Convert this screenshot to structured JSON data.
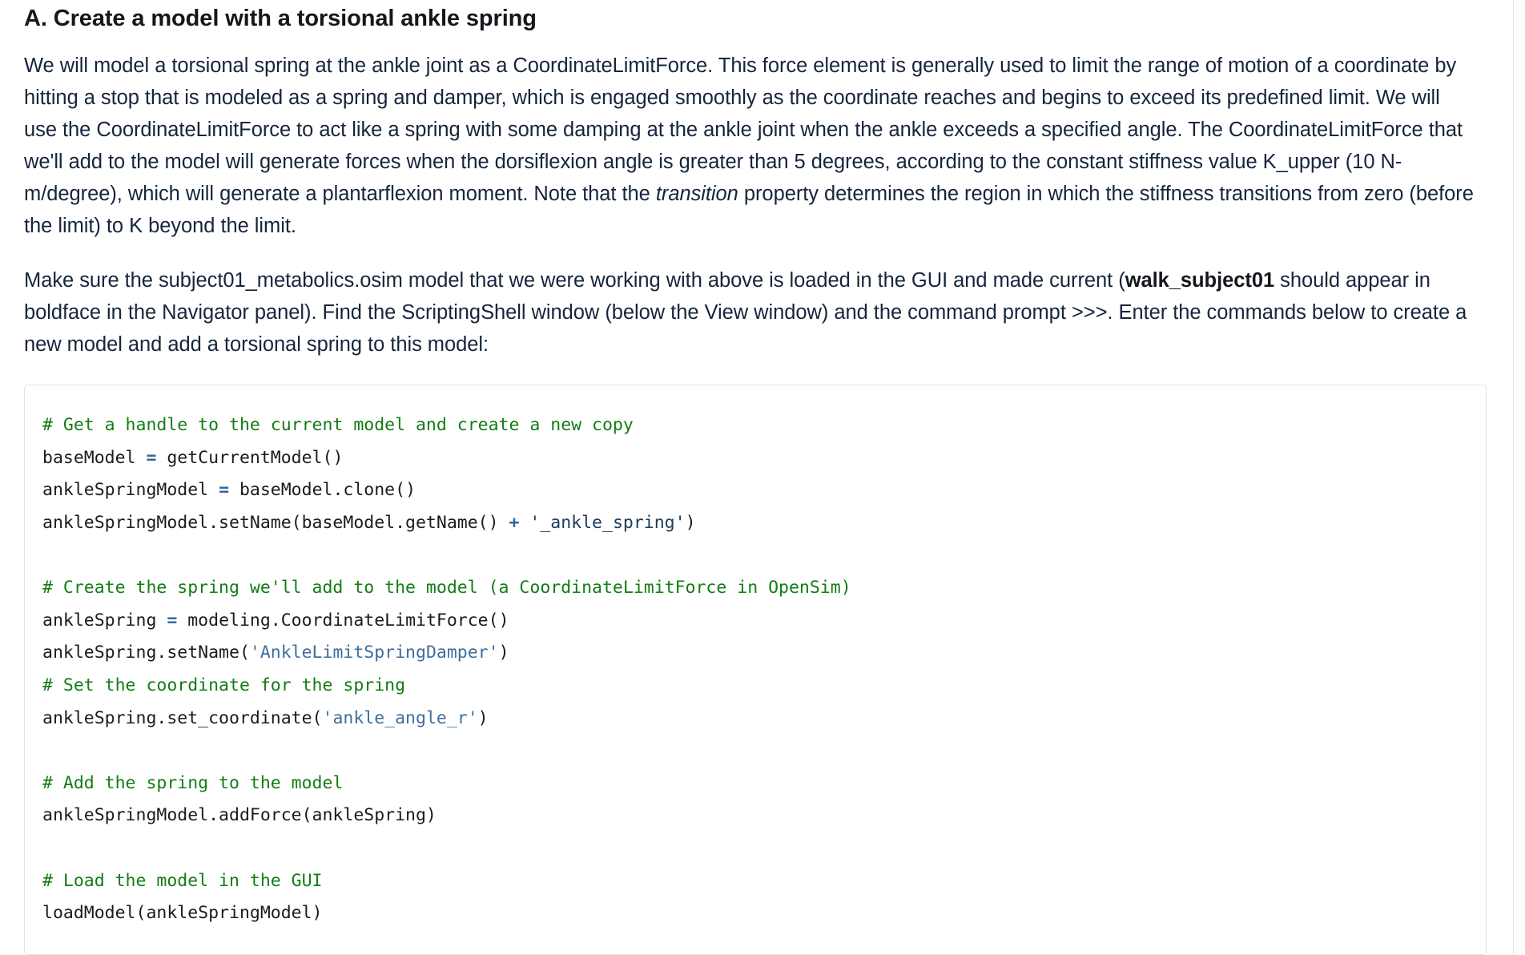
{
  "heading": "A. Create a model with a torsional ankle spring",
  "paragraphs": {
    "p1_part1": "We will model a torsional spring at the ankle joint as a CoordinateLimitForce. This force element is generally used to limit the range of motion of a coordinate by hitting a stop that is modeled as a spring and damper, which is engaged smoothly as the coordinate reaches and begins to exceed its predefined limit. We will use the CoordinateLimitForce to act like a spring with some damping at the ankle joint when the ankle exceeds a specified angle. The CoordinateLimitForce that we'll add to the model will generate forces when the dorsiflexion angle is greater than 5 degrees, according to the constant stiffness value K_upper (10 N-m/degree), which will generate a plantarflexion moment. Note that the ",
    "p1_italic": "transition",
    "p1_part2": " property determines the region in which the stiffness transitions from zero (before the limit) to K beyond the limit.",
    "p2_part1": "Make sure the subject01_metabolics.osim model that we were working with above is loaded in the GUI and made current (",
    "p2_bold": "walk_subject01",
    "p2_part2": " should appear in boldface in the Navigator panel). Find the ScriptingShell window (below the View window) and the command prompt >>>. Enter the commands below to create a new model and add a torsional spring to this model:"
  },
  "code_block": {
    "language": "python",
    "lines": [
      {
        "tokens": [
          {
            "t": "# Get a handle to the current model and create a new copy",
            "c": "comment"
          }
        ]
      },
      {
        "tokens": [
          {
            "t": "baseModel ",
            "c": "plain"
          },
          {
            "t": "=",
            "c": "op"
          },
          {
            "t": " getCurrentModel()",
            "c": "plain"
          }
        ]
      },
      {
        "tokens": [
          {
            "t": "ankleSpringModel ",
            "c": "plain"
          },
          {
            "t": "=",
            "c": "op"
          },
          {
            "t": " baseModel.clone()",
            "c": "plain"
          }
        ]
      },
      {
        "tokens": [
          {
            "t": "ankleSpringModel.setName(baseModel.getName() ",
            "c": "plain"
          },
          {
            "t": "+",
            "c": "op"
          },
          {
            "t": " ",
            "c": "plain"
          },
          {
            "t": "'_ankle_spring'",
            "c": "str-dark"
          },
          {
            "t": ")",
            "c": "plain"
          }
        ]
      },
      {
        "tokens": [
          {
            "t": "",
            "c": "plain"
          }
        ]
      },
      {
        "tokens": [
          {
            "t": "# Create the spring we'll add to the model (a CoordinateLimitForce in OpenSim)",
            "c": "comment"
          }
        ]
      },
      {
        "tokens": [
          {
            "t": "ankleSpring ",
            "c": "plain"
          },
          {
            "t": "=",
            "c": "op"
          },
          {
            "t": " modeling.CoordinateLimitForce()",
            "c": "plain"
          }
        ]
      },
      {
        "tokens": [
          {
            "t": "ankleSpring.setName(",
            "c": "plain"
          },
          {
            "t": "'AnkleLimitSpringDamper'",
            "c": "str"
          },
          {
            "t": ")",
            "c": "plain"
          }
        ]
      },
      {
        "tokens": [
          {
            "t": "# Set the coordinate for the spring",
            "c": "comment"
          }
        ]
      },
      {
        "tokens": [
          {
            "t": "ankleSpring.set_coordinate(",
            "c": "plain"
          },
          {
            "t": "'ankle_angle_r'",
            "c": "str"
          },
          {
            "t": ")",
            "c": "plain"
          }
        ]
      },
      {
        "tokens": [
          {
            "t": "",
            "c": "plain"
          }
        ]
      },
      {
        "tokens": [
          {
            "t": "# Add the spring to the model",
            "c": "comment"
          }
        ]
      },
      {
        "tokens": [
          {
            "t": "ankleSpringModel.addForce(ankleSpring)",
            "c": "plain"
          }
        ]
      },
      {
        "tokens": [
          {
            "t": "",
            "c": "plain"
          }
        ]
      },
      {
        "tokens": [
          {
            "t": "# Load the model in the GUI",
            "c": "comment"
          }
        ]
      },
      {
        "tokens": [
          {
            "t": "loadModel(ankleSpringModel)",
            "c": "plain"
          }
        ]
      }
    ]
  },
  "colors": {
    "comment": "#137c14",
    "operator": "#36689e",
    "string": "#3f6e9e",
    "string_dark": "#1c3a5e",
    "body_text": "#16253c",
    "heading": "#14171c",
    "code_border": "#e3e3e3"
  }
}
